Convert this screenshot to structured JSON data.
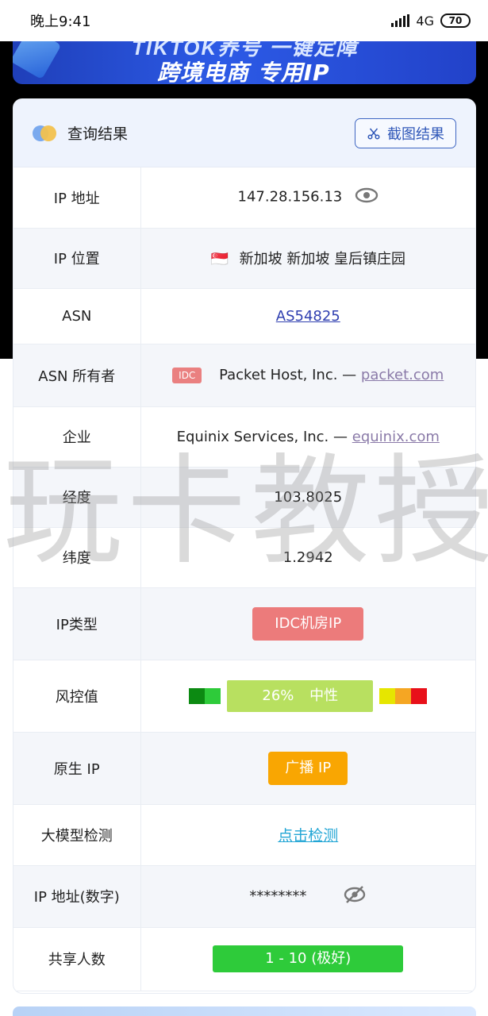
{
  "status_bar": {
    "time": "晚上9:41",
    "network": "4G",
    "battery": "70"
  },
  "banner": {
    "top_text": "TIKTOK养号 一键定障",
    "main_text": "跨境电商 专用IP"
  },
  "card": {
    "title": "查询结果",
    "screenshot_button": "截图结果"
  },
  "rows": {
    "ip": {
      "label": "IP 地址",
      "value": "147.28.156.13"
    },
    "location": {
      "label": "IP 位置",
      "flag": "🇸🇬",
      "value": "新加坡 新加坡 皇后镇庄园"
    },
    "asn": {
      "label": "ASN",
      "value": "AS54825"
    },
    "asn_owner": {
      "label": "ASN 所有者",
      "tag": "IDC",
      "name": "Packet Host, Inc. —",
      "domain": "packet.com"
    },
    "company": {
      "label": "企业",
      "name": "Equinix Services, Inc. —",
      "domain": "equinix.com"
    },
    "longitude": {
      "label": "经度",
      "value": "103.8025"
    },
    "latitude": {
      "label": "纬度",
      "value": "1.2942"
    },
    "ip_type": {
      "label": "IP类型",
      "value": "IDC机房IP"
    },
    "risk": {
      "label": "风控值",
      "percent": "26%",
      "level": "中性",
      "value_fraction": 0.26
    },
    "native": {
      "label": "原生 IP",
      "value": "广播 IP"
    },
    "llm_check": {
      "label": "大模型检测",
      "value": "点击检测"
    },
    "ip_numeric": {
      "label": "IP 地址(数字)",
      "value": "********"
    },
    "shared": {
      "label": "共享人数",
      "value": "1 - 10 (极好)"
    }
  },
  "watermark": "玩卡教授",
  "colors": {
    "accent_blue": "#2f57b8",
    "idc_red": "#ec7b7b",
    "risk_green": "#b8e060",
    "native_orange": "#f9a602",
    "share_green": "#2ecb3a",
    "link_cyan": "#23a6d5"
  }
}
